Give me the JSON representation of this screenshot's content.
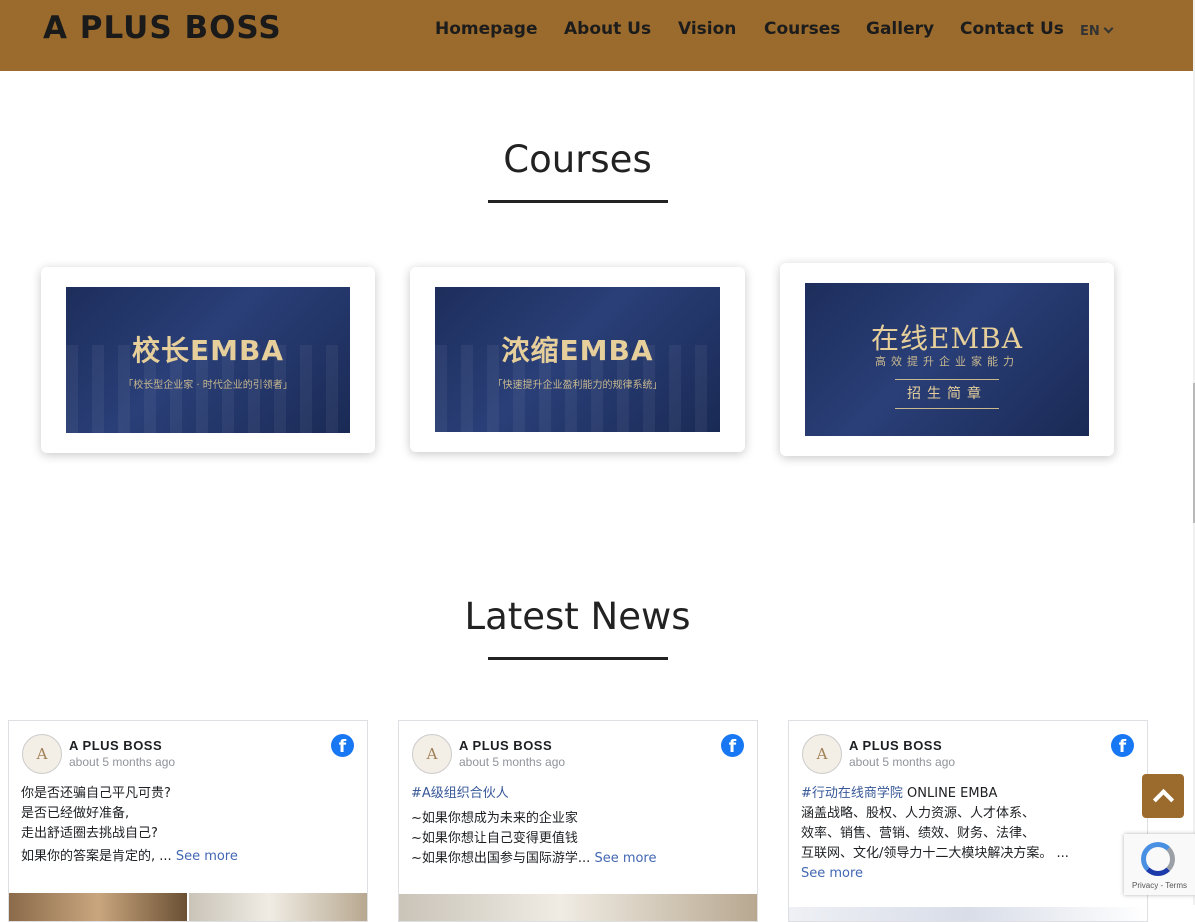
{
  "header": {
    "logo": "A PLUS BOSS",
    "nav": [
      "Homepage",
      "About Us",
      "Vision",
      "Courses",
      "Gallery",
      "Contact Us"
    ],
    "language": "EN"
  },
  "courses": {
    "title": "Courses",
    "cards": [
      {
        "title": "校长EMBA",
        "subtitle": "「校长型企业家 · 时代企业的引领者」"
      },
      {
        "title": "浓缩EMBA",
        "subtitle": "「快速提升企业盈利能力的规律系统」"
      },
      {
        "title": "在线EMBA",
        "subtitle": "高效提升企业家能力",
        "badge": "招生简章"
      }
    ]
  },
  "news": {
    "title": "Latest News",
    "posts": [
      {
        "avatar": "A",
        "page": "A PLUS BOSS",
        "time": "about 5 months ago",
        "hashtag": "",
        "lines": [
          "你是否还骗自己平凡可贵?",
          "是否已经做好准备,",
          "走出舒适圈去挑战自己?",
          "如果你的答案是肯定的, ..."
        ],
        "see_more": "See more"
      },
      {
        "avatar": "A",
        "page": "A PLUS BOSS",
        "time": "about 5 months ago",
        "hashtag": "#A级组织合伙人",
        "lines": [
          "~如果你想成为未来的企业家",
          "~如果你想让自己变得更值钱",
          "~如果你想出国参与国际游学..."
        ],
        "see_more": "See more"
      },
      {
        "avatar": "A",
        "page": "A PLUS BOSS",
        "time": "about 5 months ago",
        "hashtag": "#行动在线商学院",
        "hashtag_suffix": " ONLINE EMBA",
        "lines": [
          "涵盖战略、股权、人力资源、人才体系、",
          "效率、销售、营销、绩效、财务、法律、",
          "互联网、文化/领导力十二大模块解决方案。 ..."
        ],
        "see_more": "See more"
      }
    ]
  },
  "recaptcha": {
    "terms": "Privacy - Terms"
  }
}
